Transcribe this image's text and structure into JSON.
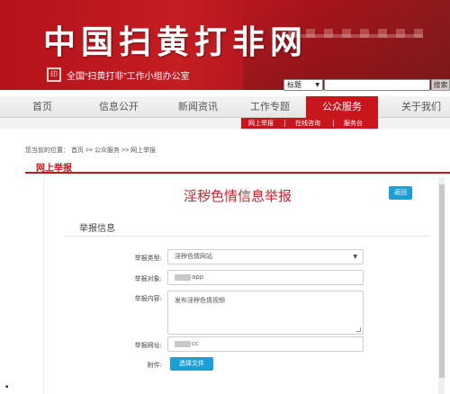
{
  "header": {
    "site_title": "中国扫黄打非网",
    "seal_text": "印",
    "subtitle": "全国“扫黄打非”工作小组办公室",
    "search_select": "标题",
    "search_button": "搜索"
  },
  "nav": {
    "items": [
      "首页",
      "信息公开",
      "新闻资讯",
      "工作专题",
      "公众服务",
      "关于我们"
    ],
    "active_item": "公众服务",
    "sub_items": [
      "网上举报",
      "在线咨询",
      "服务台"
    ]
  },
  "breadcrumb": "您当前的位置： 首页 >> 公众服务 >> 网上举报",
  "section_title": "网上举报",
  "form": {
    "title": "淫秽色情信息举报",
    "back_button": "返回",
    "section_label": "举报信息",
    "fields": [
      {
        "label": "举报类型:",
        "value": "淫秽色情网站"
      },
      {
        "label": "举报对象:",
        "value": "app"
      },
      {
        "label": "举报内容:",
        "value": "发布淫秽色情视频"
      },
      {
        "label": "举报网址:",
        "value": "cc"
      },
      {
        "label": "附件:",
        "value": "选择文件"
      }
    ]
  },
  "bullet": "•",
  "colors": {
    "brand_red": "#c8161d",
    "title_red": "#d71e28",
    "button_blue": "#1aa0d8"
  }
}
